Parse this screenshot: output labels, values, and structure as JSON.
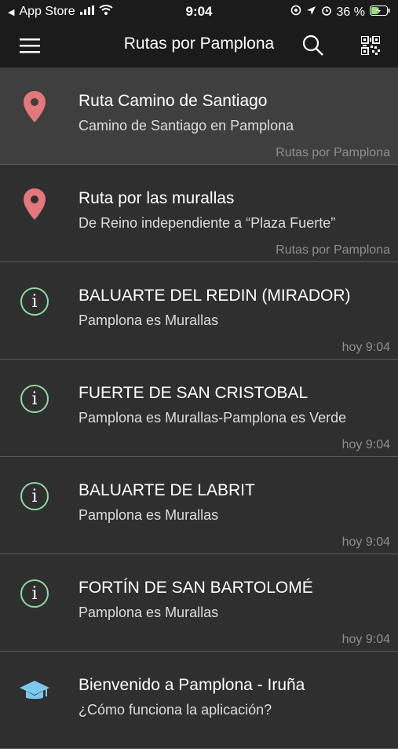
{
  "status_bar": {
    "back_app": "App Store",
    "time": "9:04",
    "battery": "36 %"
  },
  "nav": {
    "title": "Rutas por Pamplona",
    "menu_icon": "hamburger-icon",
    "search_icon": "search-icon",
    "qr_icon": "qr-code-icon"
  },
  "colors": {
    "pin": "#e3777b",
    "info_ring": "#8fd8a0",
    "edu": "#7ec7ec"
  },
  "items": [
    {
      "icon": "map-pin-icon",
      "title": "Ruta Camino de Santiago",
      "subtitle": "Camino de Santiago en Pamplona",
      "meta": "Rutas por Pamplona",
      "selected": true
    },
    {
      "icon": "map-pin-icon",
      "title": "Ruta por las murallas",
      "subtitle": "De Reino independiente a “Plaza Fuerte”",
      "meta": "Rutas por Pamplona"
    },
    {
      "icon": "info-icon",
      "title": "BALUARTE DEL REDIN (MIRADOR)",
      "subtitle": "Pamplona es Murallas",
      "meta": "hoy 9:04"
    },
    {
      "icon": "info-icon",
      "title": "FUERTE DE SAN CRISTOBAL",
      "subtitle": "Pamplona es Murallas-Pamplona es Verde",
      "meta": "hoy 9:04"
    },
    {
      "icon": "info-icon",
      "title": "BALUARTE DE LABRIT",
      "subtitle": "Pamplona es Murallas",
      "meta": "hoy 9:04"
    },
    {
      "icon": "info-icon",
      "title": "FORTÍN DE SAN BARTOLOMÉ",
      "subtitle": "Pamplona es Murallas",
      "meta": "hoy 9:04"
    },
    {
      "icon": "graduation-cap-icon",
      "title": "Bienvenido a Pamplona - Iruña",
      "subtitle": "¿Cómo funciona la aplicación?",
      "meta": ""
    }
  ]
}
